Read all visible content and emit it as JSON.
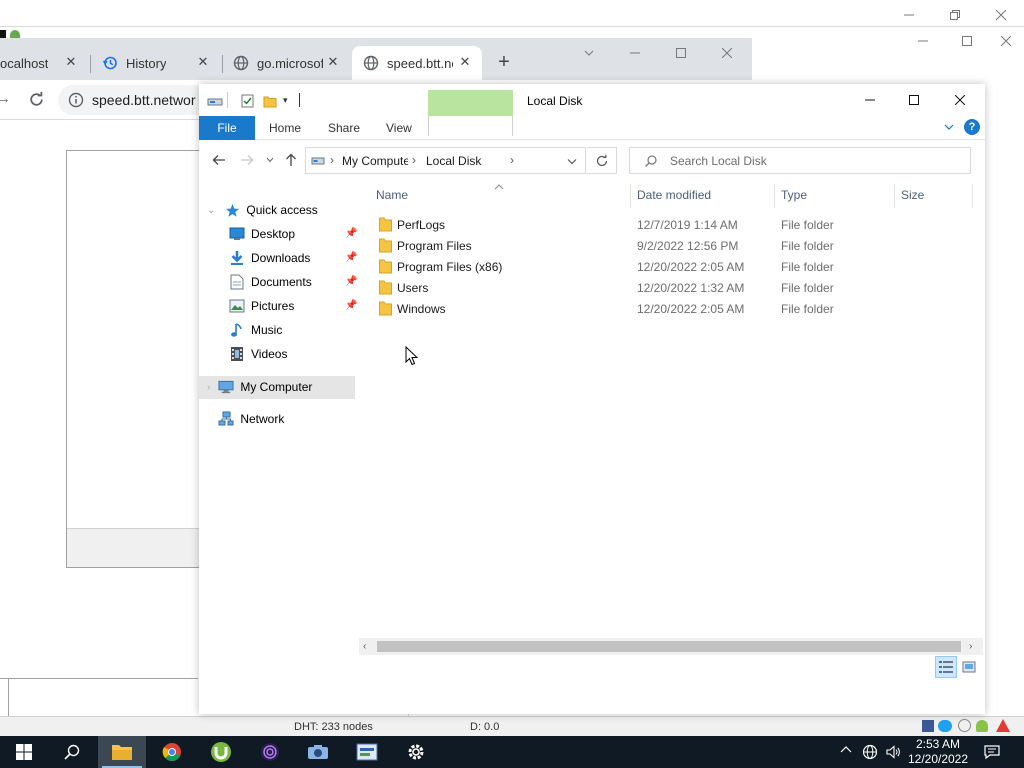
{
  "background_window": {
    "status_dht": "DHT: 233 nodes",
    "status_d": "D: 0.0"
  },
  "chrome": {
    "tabs": [
      {
        "title": "ocalhost",
        "icon": "none"
      },
      {
        "title": "History",
        "icon": "history-icon"
      },
      {
        "title": "go.microsof",
        "icon": "globe-icon"
      },
      {
        "title": "speed.btt.ne",
        "icon": "globe-icon",
        "active": true
      }
    ],
    "new_tab_label": "+",
    "url": "speed.btt.networ"
  },
  "explorer": {
    "title": "Local Disk",
    "ribbon_tabs": {
      "file": "File",
      "home": "Home",
      "share": "Share",
      "view": "View"
    },
    "breadcrumb": [
      "My Computer",
      "Local Disk"
    ],
    "search_placeholder": "Search Local Disk",
    "columns": {
      "name": "Name",
      "date": "Date modified",
      "type": "Type",
      "size": "Size"
    },
    "nav": {
      "quick_access": "Quick access",
      "items": [
        {
          "label": "Desktop",
          "pinned": true,
          "icon": "desktop-icon"
        },
        {
          "label": "Downloads",
          "pinned": true,
          "icon": "downloads-icon"
        },
        {
          "label": "Documents",
          "pinned": true,
          "icon": "documents-icon"
        },
        {
          "label": "Pictures",
          "pinned": true,
          "icon": "pictures-icon"
        },
        {
          "label": "Music",
          "pinned": false,
          "icon": "music-icon"
        },
        {
          "label": "Videos",
          "pinned": false,
          "icon": "videos-icon"
        }
      ],
      "my_computer": "My Computer",
      "network": "Network"
    },
    "files": [
      {
        "name": "PerfLogs",
        "date": "12/7/2019 1:14 AM",
        "type": "File folder"
      },
      {
        "name": "Program Files",
        "date": "9/2/2022 12:56 PM",
        "type": "File folder"
      },
      {
        "name": "Program Files (x86)",
        "date": "12/20/2022 2:05 AM",
        "type": "File folder"
      },
      {
        "name": "Users",
        "date": "12/20/2022 1:32 AM",
        "type": "File folder"
      },
      {
        "name": "Windows",
        "date": "12/20/2022 2:05 AM",
        "type": "File folder"
      }
    ]
  },
  "taskbar": {
    "time": "2:53 AM",
    "date": "12/20/2022"
  },
  "colors": {
    "accent": "#1979ca",
    "folder": "#f5c542",
    "selected_nav": "#e5e5e5",
    "drive_tools": "#b8e4a0"
  }
}
